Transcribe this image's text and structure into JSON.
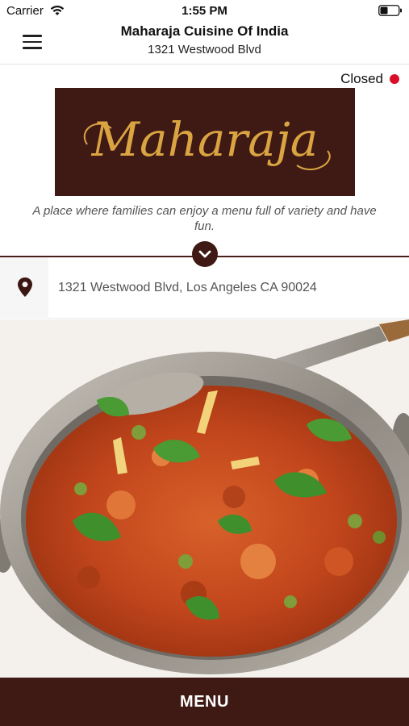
{
  "status_bar": {
    "carrier": "Carrier",
    "time": "1:55 PM",
    "icons": [
      "wifi-icon",
      "battery-icon"
    ]
  },
  "header": {
    "title": "Maharaja Cuisine Of India",
    "subtitle": "1321 Westwood Blvd",
    "menu_icon": "hamburger-menu-icon"
  },
  "restaurant": {
    "open_status": "Closed",
    "status_color": "#d90f2a",
    "logo_text": "Maharaja",
    "tagline": "A place where families can enjoy a menu full of variety and have fun.",
    "address": "1321 Westwood Blvd, Los Angeles CA 90024",
    "address_icon": "location-pin-icon",
    "expand_icon": "chevron-down-icon"
  },
  "hero_image": {
    "description": "bowl of vegetable curry with cilantro and ginger"
  },
  "bottom_bar": {
    "label": "MENU"
  },
  "colors": {
    "brand_dark": "#3f1a14",
    "logo_gold": "#d9a441",
    "status_red": "#d90f2a"
  }
}
